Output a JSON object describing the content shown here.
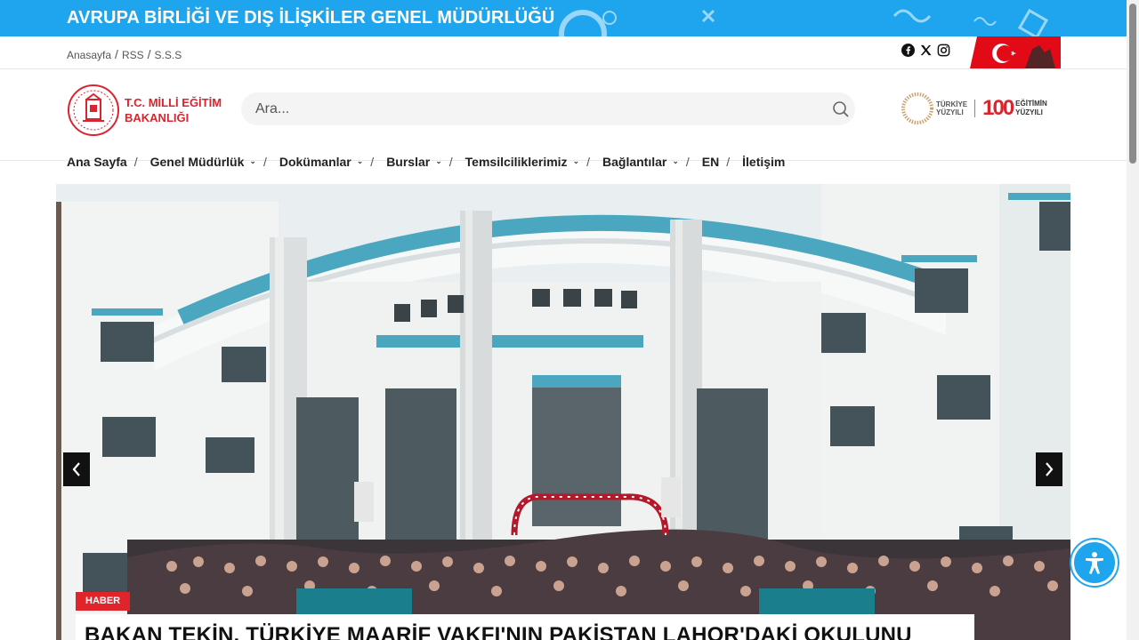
{
  "banner": {
    "title": "AVRUPA BİRLİĞİ VE DIŞ İLİŞKİLER GENEL MÜDÜRLÜĞÜ"
  },
  "utility": {
    "links": [
      {
        "label": "Anasayfa"
      },
      {
        "label": "RSS"
      },
      {
        "label": "S.S.S"
      }
    ],
    "separator": "/",
    "social_icons": [
      "facebook-icon",
      "x-icon",
      "instagram-icon"
    ]
  },
  "header": {
    "logo_line1": "T.C. MİLLİ EĞİTİM",
    "logo_line2": "BAKANLIĞI",
    "search_placeholder": "Ara...",
    "turkiye_line1": "TÜRKİYE",
    "turkiye_line2": "YÜZYILI",
    "hundred": "100",
    "egitim_line1": "EĞİTİMİN",
    "egitim_line2": "YÜZYILI"
  },
  "nav": {
    "separator": "/",
    "items": [
      {
        "label": "Ana Sayfa"
      },
      {
        "label": "Genel Müdürlük"
      },
      {
        "label": "Dokümanlar"
      },
      {
        "label": "Burslar"
      },
      {
        "label": "Temsilciliklerimiz"
      },
      {
        "label": "Bağlantılar"
      },
      {
        "label": "EN"
      },
      {
        "label": "İletişim"
      }
    ]
  },
  "slider": {
    "badge": "HABER",
    "headline": "BAKAN TEKİN, TÜRKİYE MAARİF VAKFI'NIN PAKİSTAN LAHOR'DAKİ OKULUNU"
  },
  "colors": {
    "accent_blue": "#1ea5ee",
    "brand_red": "#d8252f",
    "badge_red": "#e0242b"
  }
}
